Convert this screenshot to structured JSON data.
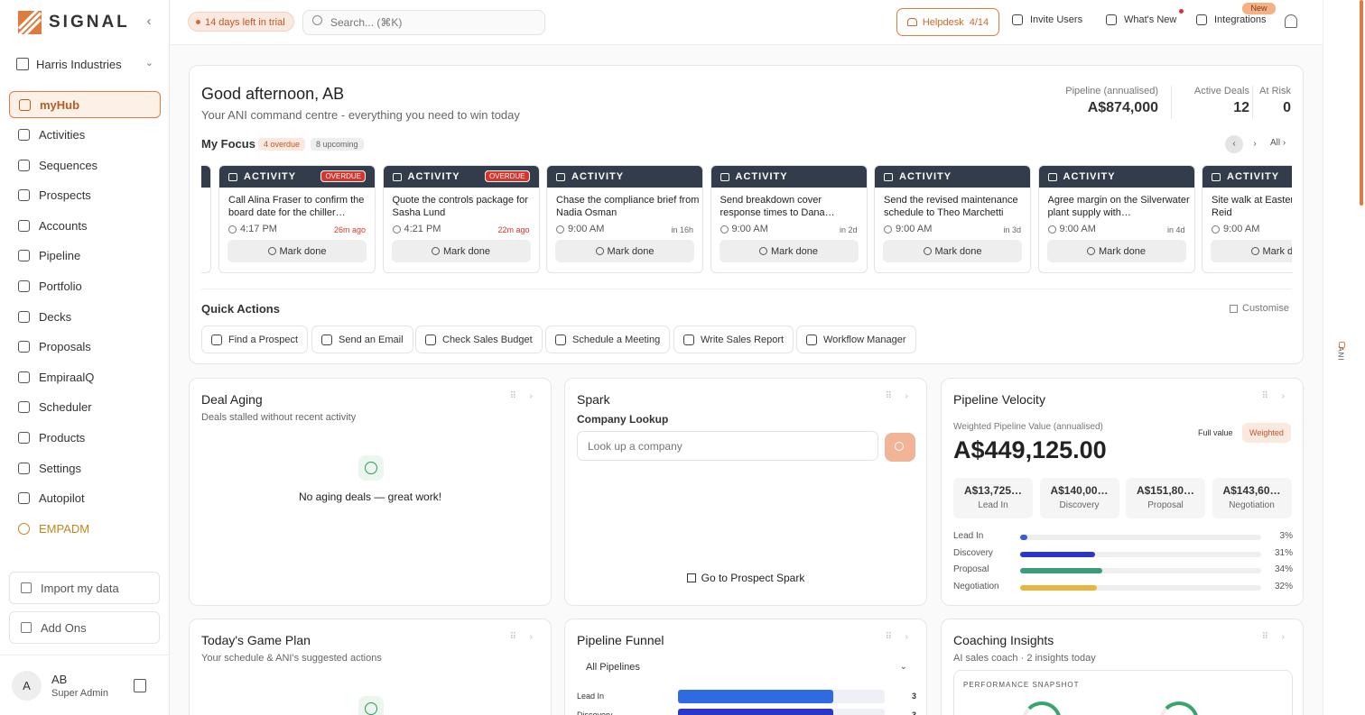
{
  "brand": {
    "name": "SIGNAL",
    "accent": "#e07b3f"
  },
  "org": {
    "name": "Harris Industries"
  },
  "nav": [
    {
      "label": "myHub",
      "icon": "home-icon",
      "active": true
    },
    {
      "label": "Activities",
      "icon": "calendar-icon"
    },
    {
      "label": "Sequences",
      "icon": "list-icon"
    },
    {
      "label": "Prospects",
      "icon": "users-icon"
    },
    {
      "label": "Accounts",
      "icon": "building-icon"
    },
    {
      "label": "Pipeline",
      "icon": "kanban-icon"
    },
    {
      "label": "Portfolio",
      "icon": "bar-chart-icon"
    },
    {
      "label": "Decks",
      "icon": "layers-icon"
    },
    {
      "label": "Proposals",
      "icon": "document-icon"
    },
    {
      "label": "EmpiraalQ",
      "icon": "brain-icon"
    },
    {
      "label": "Scheduler",
      "icon": "calendar-icon"
    },
    {
      "label": "Products",
      "icon": "box-icon"
    },
    {
      "label": "Settings",
      "icon": "gear-icon"
    },
    {
      "label": "Autopilot",
      "icon": "bolt-icon"
    },
    {
      "label": "EMPADM",
      "icon": "shield-icon"
    }
  ],
  "sidebar_footer": {
    "import": "Import my data",
    "addons": "Add Ons"
  },
  "user": {
    "initial": "A",
    "name": "AB",
    "role": "Super Admin"
  },
  "topbar": {
    "trial": "14 days left in trial",
    "search_placeholder": "Search... (⌘K)",
    "helpdesk": "Helpdesk",
    "helpdesk_count": "4/14",
    "invite": "Invite Users",
    "whats_new": "What's New",
    "integrations": "Integrations",
    "new_badge": "New"
  },
  "rail": {
    "label": "ANI"
  },
  "hero": {
    "greeting": "Good afternoon, AB",
    "subtitle": "Your ANI command centre - everything you need to win today",
    "stats": [
      {
        "label": "Pipeline (annualised)",
        "value": "A$874,000"
      },
      {
        "label": "Active Deals",
        "value": "12"
      },
      {
        "label": "At Risk",
        "value": "0"
      }
    ],
    "focus_title": "My Focus",
    "overdue_chip": "4 overdue",
    "upcoming_chip": "8 upcoming",
    "all_link": "All",
    "cards": [
      {
        "type": "ACTIVITY",
        "badge": "OVERDUE",
        "title": "Call Alina Fraser to confirm the board date for the chiller…",
        "time": "4:17 PM",
        "ago": "26m ago",
        "overdue": true,
        "action": "Mark done"
      },
      {
        "type": "ACTIVITY",
        "badge": "OVERDUE",
        "title": "Quote the controls package for Sasha Lund",
        "time": "4:21 PM",
        "ago": "22m ago",
        "overdue": true,
        "action": "Mark done"
      },
      {
        "type": "ACTIVITY",
        "badge": "",
        "title": "Chase the compliance brief from Nadia Osman",
        "time": "9:00 AM",
        "ago": "in 16h",
        "overdue": false,
        "action": "Mark done"
      },
      {
        "type": "ACTIVITY",
        "badge": "",
        "title": "Send breakdown cover response times to Dana…",
        "time": "9:00 AM",
        "ago": "in 2d",
        "overdue": false,
        "action": "Mark done"
      },
      {
        "type": "ACTIVITY",
        "badge": "",
        "title": "Send the revised maintenance schedule to Theo Marchetti",
        "time": "9:00 AM",
        "ago": "in 3d",
        "overdue": false,
        "action": "Mark done"
      },
      {
        "type": "ACTIVITY",
        "badge": "",
        "title": "Agree margin on the Silverwater plant supply with…",
        "time": "9:00 AM",
        "ago": "in 4d",
        "overdue": false,
        "action": "Mark done"
      },
      {
        "type": "ACTIVITY",
        "badge": "",
        "title": "Site walk at Eastern Callum Reid",
        "time": "9:00 AM",
        "ago": "",
        "overdue": false,
        "action": "Mark done"
      }
    ],
    "quick_actions_title": "Quick Actions",
    "customise": "Customise",
    "quick_actions": [
      {
        "label": "Find a Prospect",
        "icon": "user-search-icon"
      },
      {
        "label": "Send an Email",
        "icon": "mail-icon"
      },
      {
        "label": "Check Sales Budget",
        "icon": "bar-chart-icon"
      },
      {
        "label": "Schedule a Meeting",
        "icon": "calendar-icon"
      },
      {
        "label": "Write Sales Report",
        "icon": "trend-icon"
      },
      {
        "label": "Workflow Manager",
        "icon": "bolt-icon"
      }
    ]
  },
  "deal_aging": {
    "title": "Deal Aging",
    "subtitle": "Deals stalled without recent activity",
    "empty": "No aging deals — great work!"
  },
  "spark": {
    "title": "Spark",
    "lookup_label": "Company Lookup",
    "lookup_placeholder": "Look up a company",
    "goto": "Go to Prospect Spark"
  },
  "velocity": {
    "title": "Pipeline Velocity",
    "value_label": "Weighted Pipeline Value (annualised)",
    "value": "A$449,125.00",
    "toggle_full": "Full value",
    "toggle_weighted": "Weighted",
    "stages": [
      {
        "value": "A$13,725…",
        "label": "Lead In"
      },
      {
        "value": "A$140,00…",
        "label": "Discovery"
      },
      {
        "value": "A$151,80…",
        "label": "Proposal"
      },
      {
        "value": "A$143,60…",
        "label": "Negotiation"
      }
    ],
    "bars": [
      {
        "label": "Lead In",
        "pct": 3,
        "pct_label": "3%",
        "color": "#3b5bdb"
      },
      {
        "label": "Discovery",
        "pct": 31,
        "pct_label": "31%",
        "color": "#2b35c9"
      },
      {
        "label": "Proposal",
        "pct": 34,
        "pct_label": "34%",
        "color": "#3d9a7a"
      },
      {
        "label": "Negotiation",
        "pct": 32,
        "pct_label": "32%",
        "color": "#e8b63f"
      }
    ]
  },
  "game_plan": {
    "title": "Today's Game Plan",
    "subtitle": "Your schedule & ANI's suggested actions"
  },
  "funnel": {
    "title": "Pipeline Funnel",
    "select": "All Pipelines",
    "rows": [
      {
        "label": "Lead In",
        "value": "3",
        "frac": 0.75,
        "color": "#2f6be0"
      },
      {
        "label": "Discovery",
        "value": "3",
        "frac": 0.75,
        "color": "#2b35c9"
      }
    ]
  },
  "coaching": {
    "title": "Coaching Insights",
    "subtitle": "AI sales coach · 2 insights today",
    "snapshot": "PERFORMANCE SNAPSHOT"
  }
}
